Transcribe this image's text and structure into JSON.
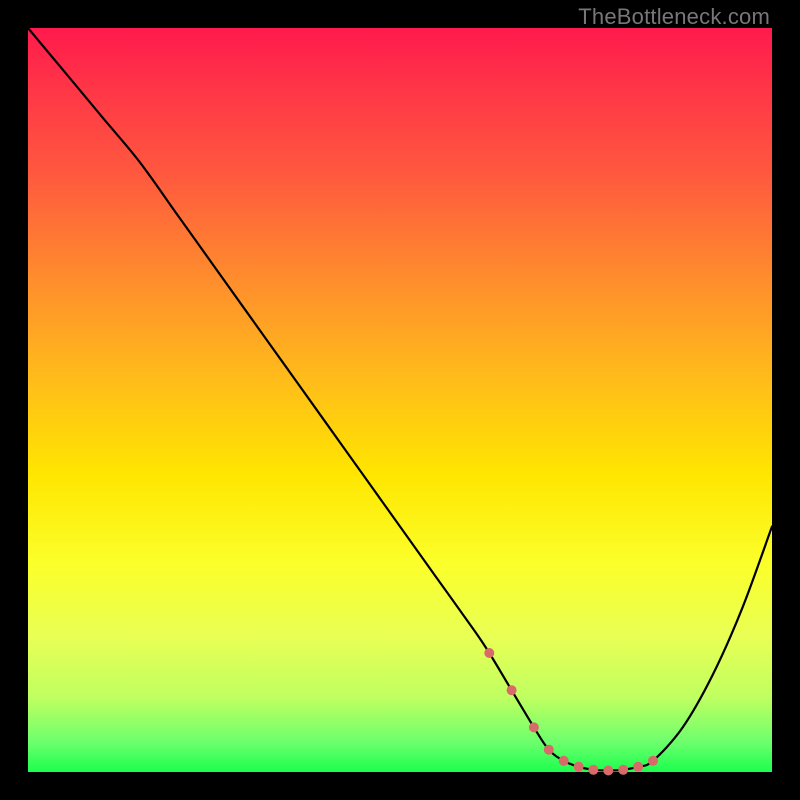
{
  "watermark": "TheBottleneck.com",
  "chart_data": {
    "type": "line",
    "title": "",
    "xlabel": "",
    "ylabel": "",
    "xlim": [
      0,
      100
    ],
    "ylim": [
      0,
      100
    ],
    "grid": false,
    "x": [
      0,
      5,
      10,
      15,
      20,
      25,
      30,
      35,
      40,
      45,
      50,
      55,
      60,
      62,
      65,
      68,
      70,
      72,
      74,
      76,
      78,
      80,
      82,
      84,
      88,
      92,
      96,
      100
    ],
    "values": [
      100,
      94,
      88,
      82,
      75,
      68,
      61,
      54,
      47,
      40,
      33,
      26,
      19,
      16,
      11,
      6,
      3,
      1.5,
      0.7,
      0.3,
      0.2,
      0.3,
      0.7,
      1.5,
      6,
      13,
      22,
      33
    ],
    "markers_x": [
      62,
      65,
      68,
      70,
      72,
      74,
      76,
      78,
      80,
      82,
      84
    ],
    "markers_y": [
      16,
      11,
      6,
      3,
      1.5,
      0.7,
      0.3,
      0.2,
      0.3,
      0.7,
      1.5
    ],
    "marker_color": "#d86a6a",
    "line_color": "#000000",
    "gradient_stops": [
      {
        "pos": 0,
        "color": "#ff1a4d"
      },
      {
        "pos": 20,
        "color": "#ff5a3e"
      },
      {
        "pos": 46,
        "color": "#ffb81c"
      },
      {
        "pos": 72,
        "color": "#fbff2a"
      },
      {
        "pos": 100,
        "color": "#1aff4d"
      }
    ]
  }
}
